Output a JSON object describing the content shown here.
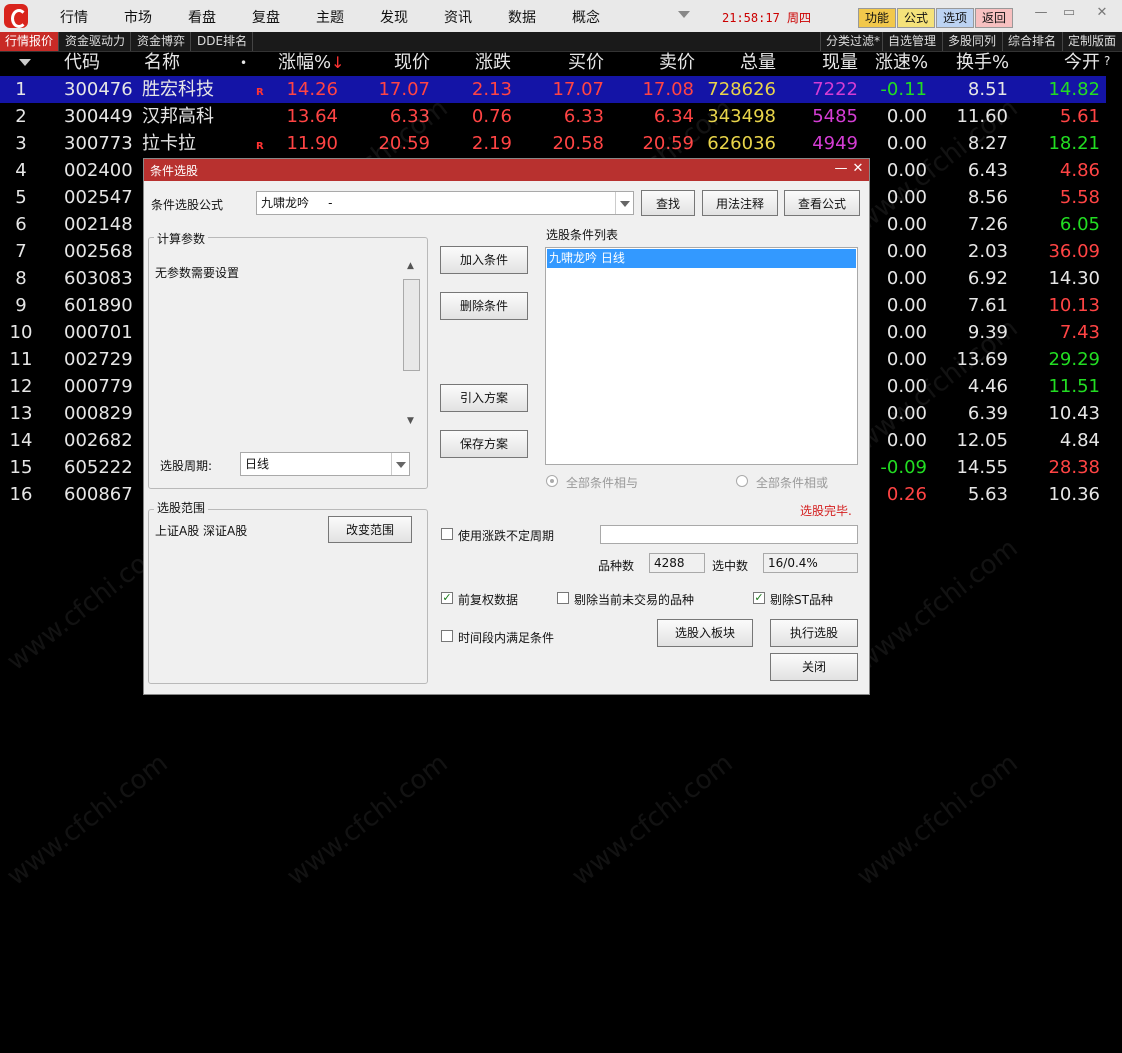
{
  "menu": {
    "items": [
      "行情",
      "市场",
      "看盘",
      "复盘",
      "主题",
      "发现",
      "资讯",
      "数据",
      "概念"
    ],
    "clock": "21:58:17 周四",
    "buttons": [
      {
        "label": "功能",
        "color": "#f2c84b"
      },
      {
        "label": "公式",
        "color": "#f5e27a"
      },
      {
        "label": "选项",
        "color": "#bcd3f2"
      },
      {
        "label": "返回",
        "color": "#f7c0c0"
      }
    ]
  },
  "tabs": {
    "left": [
      "行情报价",
      "资金驱动力",
      "资金博弈",
      "DDE排名"
    ],
    "right": [
      "分类过滤*",
      "自选管理",
      "多股同列",
      "综合排名",
      "定制版面"
    ]
  },
  "grid": {
    "headers": {
      "code": "代码",
      "name": "名称",
      "dot": "•",
      "pct": "涨幅%",
      "pct_sort": "↓",
      "price": "现价",
      "chg": "涨跌",
      "bid": "买价",
      "ask": "卖价",
      "vol": "总量",
      "cur": "现量",
      "spd": "涨速%",
      "turn": "换手%",
      "open": "今开",
      "help": "?"
    },
    "rows": [
      {
        "idx": "1",
        "code": "300476",
        "name": "胜宏科技",
        "r": "R",
        "pct": "14.26",
        "price": "17.07",
        "chg": "2.13",
        "bid": "17.07",
        "ask": "17.08",
        "vol": "728626",
        "cur": "7222",
        "spd": "-0.11",
        "turn": "8.51",
        "open": "14.82",
        "spd_color": "#22dd22",
        "open_color": "#22dd22"
      },
      {
        "idx": "2",
        "code": "300449",
        "name": "汉邦高科",
        "r": "",
        "pct": "13.64",
        "price": "6.33",
        "chg": "0.76",
        "bid": "6.33",
        "ask": "6.34",
        "vol": "343498",
        "cur": "5485",
        "spd": "0.00",
        "turn": "11.60",
        "open": "5.61",
        "spd_color": "#e6e6e6",
        "open_color": "#ff4444"
      },
      {
        "idx": "3",
        "code": "300773",
        "name": "拉卡拉",
        "r": "R",
        "pct": "11.90",
        "price": "20.59",
        "chg": "2.19",
        "bid": "20.58",
        "ask": "20.59",
        "vol": "626036",
        "cur": "4949",
        "spd": "0.00",
        "turn": "8.27",
        "open": "18.21",
        "spd_color": "#e6e6e6",
        "open_color": "#22dd22"
      },
      {
        "idx": "4",
        "code": "002400",
        "name": "",
        "r": "",
        "pct": "",
        "price": "",
        "chg": "",
        "bid": "",
        "ask": "",
        "vol": "",
        "cur": "",
        "spd": "0.00",
        "turn": "6.43",
        "open": "4.86",
        "spd_color": "#e6e6e6",
        "open_color": "#ff4444"
      },
      {
        "idx": "5",
        "code": "002547",
        "name": "",
        "r": "",
        "pct": "",
        "price": "",
        "chg": "",
        "bid": "",
        "ask": "",
        "vol": "",
        "cur": "",
        "spd": "0.00",
        "turn": "8.56",
        "open": "5.58",
        "spd_color": "#e6e6e6",
        "open_color": "#ff4444"
      },
      {
        "idx": "6",
        "code": "002148",
        "name": "",
        "r": "",
        "pct": "",
        "price": "",
        "chg": "",
        "bid": "",
        "ask": "",
        "vol": "",
        "cur": "",
        "spd": "0.00",
        "turn": "7.26",
        "open": "6.05",
        "spd_color": "#e6e6e6",
        "open_color": "#22dd22"
      },
      {
        "idx": "7",
        "code": "002568",
        "name": "",
        "r": "",
        "pct": "",
        "price": "",
        "chg": "",
        "bid": "",
        "ask": "",
        "vol": "",
        "cur": "",
        "spd": "0.00",
        "turn": "2.03",
        "open": "36.09",
        "spd_color": "#e6e6e6",
        "open_color": "#ff4444"
      },
      {
        "idx": "8",
        "code": "603083",
        "name": "",
        "r": "",
        "pct": "",
        "price": "",
        "chg": "",
        "bid": "",
        "ask": "",
        "vol": "",
        "cur": "",
        "spd": "0.00",
        "turn": "6.92",
        "open": "14.30",
        "spd_color": "#e6e6e6",
        "open_color": "#e6e6e6"
      },
      {
        "idx": "9",
        "code": "601890",
        "name": "",
        "r": "",
        "pct": "",
        "price": "",
        "chg": "",
        "bid": "",
        "ask": "",
        "vol": "",
        "cur": "",
        "spd": "0.00",
        "turn": "7.61",
        "open": "10.13",
        "spd_color": "#e6e6e6",
        "open_color": "#ff4444"
      },
      {
        "idx": "10",
        "code": "000701",
        "name": "",
        "r": "",
        "pct": "",
        "price": "",
        "chg": "",
        "bid": "",
        "ask": "",
        "vol": "",
        "cur": "",
        "spd": "0.00",
        "turn": "9.39",
        "open": "7.43",
        "spd_color": "#e6e6e6",
        "open_color": "#ff4444"
      },
      {
        "idx": "11",
        "code": "002729",
        "name": "",
        "r": "",
        "pct": "",
        "price": "",
        "chg": "",
        "bid": "",
        "ask": "",
        "vol": "",
        "cur": "",
        "spd": "0.00",
        "turn": "13.69",
        "open": "29.29",
        "spd_color": "#e6e6e6",
        "open_color": "#22dd22"
      },
      {
        "idx": "12",
        "code": "000779",
        "name": "",
        "r": "",
        "pct": "",
        "price": "",
        "chg": "",
        "bid": "",
        "ask": "",
        "vol": "",
        "cur": "",
        "spd": "0.00",
        "turn": "4.46",
        "open": "11.51",
        "spd_color": "#e6e6e6",
        "open_color": "#22dd22"
      },
      {
        "idx": "13",
        "code": "000829",
        "name": "",
        "r": "",
        "pct": "",
        "price": "",
        "chg": "",
        "bid": "",
        "ask": "",
        "vol": "",
        "cur": "",
        "spd": "0.00",
        "turn": "6.39",
        "open": "10.43",
        "spd_color": "#e6e6e6",
        "open_color": "#e6e6e6"
      },
      {
        "idx": "14",
        "code": "002682",
        "name": "",
        "r": "",
        "pct": "",
        "price": "",
        "chg": "",
        "bid": "",
        "ask": "",
        "vol": "",
        "cur": "",
        "spd": "0.00",
        "turn": "12.05",
        "open": "4.84",
        "spd_color": "#e6e6e6",
        "open_color": "#e6e6e6"
      },
      {
        "idx": "15",
        "code": "605222",
        "name": "",
        "r": "",
        "pct": "",
        "price": "",
        "chg": "",
        "bid": "",
        "ask": "",
        "vol": "",
        "cur": "",
        "spd": "-0.09",
        "turn": "14.55",
        "open": "28.38",
        "spd_color": "#22dd22",
        "open_color": "#ff4444"
      },
      {
        "idx": "16",
        "code": "600867",
        "name": "",
        "r": "",
        "pct": "",
        "price": "",
        "chg": "",
        "bid": "",
        "ask": "",
        "vol": "",
        "cur": "",
        "spd": "0.26",
        "turn": "5.63",
        "open": "10.36",
        "spd_color": "#ff4444",
        "open_color": "#e6e6e6"
      }
    ]
  },
  "watermark": "www.cfchi.com",
  "dialog": {
    "title": "条件选股",
    "formula_label": "条件选股公式",
    "formula_value": "九啸龙吟     -",
    "find": "查找",
    "usage": "用法注释",
    "view_formula": "查看公式",
    "params_title": "计算参数",
    "params_text": "无参数需要设置",
    "period_label": "选股周期:",
    "period_value": "日线",
    "add_condition": "加入条件",
    "del_condition": "删除条件",
    "import_plan": "引入方案",
    "save_plan": "保存方案",
    "cond_list_label": "选股条件列表",
    "cond_items": [
      "九啸龙吟  日线"
    ],
    "radio_and": "全部条件相与",
    "radio_or": "全部条件相或",
    "done_text": "选股完毕.",
    "range_title": "选股范围",
    "range_value": "上证A股 深证A股",
    "change_range": "改变范围",
    "use_uncertain": "使用涨跌不定周期",
    "count_label": "品种数",
    "count_value": "4288",
    "selected_label": "选中数",
    "selected_value": "16/0.4%",
    "pre_adjust": "前复权数据",
    "exclude_untraded": "剔除当前未交易的品种",
    "exclude_st": "剔除ST品种",
    "time_within": "时间段内满足条件",
    "to_block": "选股入板块",
    "execute": "执行选股",
    "close": "关闭"
  }
}
